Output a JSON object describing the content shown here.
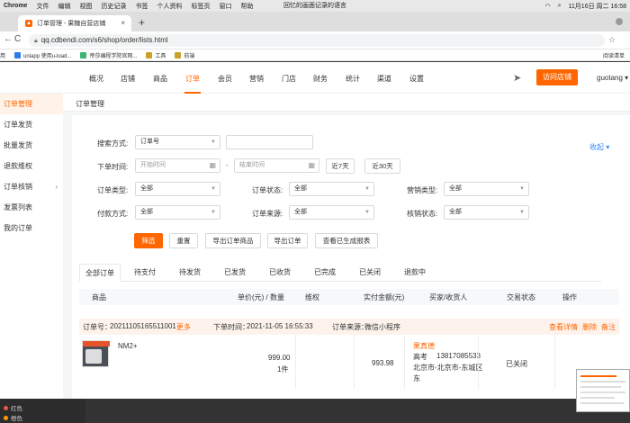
{
  "menubar": {
    "app": "Chrome",
    "items": [
      "文件",
      "编辑",
      "视图",
      "历史记录",
      "书签",
      "个人资料",
      "标签页",
      "窗口",
      "帮助"
    ],
    "center_text": "回忆的画面记录的语言",
    "clock": "11月16日 周二 16:58"
  },
  "tab": {
    "title": "订单管理 - 果糖自营店铺",
    "close": "×",
    "new": "+"
  },
  "address": {
    "url": "qq.cdbendi.com/s6/shop/order/lists.html",
    "back": "←",
    "forward": "→",
    "reload": "C",
    "star": "☆"
  },
  "bookmarks": {
    "items": [
      "用",
      "uniapp 使用u-load...",
      "帝莎编程学院官网...",
      "工具",
      "前端"
    ],
    "right": "阅读清单"
  },
  "topnav": {
    "items": [
      "概况",
      "店铺",
      "商品",
      "订单",
      "会员",
      "营销",
      "门店",
      "财务",
      "统计",
      "渠道",
      "设置"
    ],
    "active_index": 3,
    "visit_button": "访问店铺",
    "user": "guotang ▾"
  },
  "sidebar": {
    "items": [
      {
        "label": "订单管理",
        "active": true
      },
      {
        "label": "订单发货",
        "active": false
      },
      {
        "label": "批量发货",
        "active": false
      },
      {
        "label": "退款维权",
        "active": false
      },
      {
        "label": "订单核销",
        "active": false,
        "chevron": "›"
      },
      {
        "label": "发票列表",
        "active": false
      },
      {
        "label": "我的订单",
        "active": false
      }
    ]
  },
  "breadcrumb": "订单管理",
  "filters": {
    "search_label": "搜索方式:",
    "search_select": "订单号",
    "time_label": "下单时间:",
    "start_placeholder": "开始时间",
    "dash": "-",
    "end_placeholder": "结束时间",
    "last7": "近7天",
    "last30": "近30天",
    "collapse": "收起 ▾",
    "order_type_label": "订单类型:",
    "order_type": "全部",
    "order_status_label": "订单状态:",
    "order_status": "全部",
    "marketing_type_label": "营销类型:",
    "marketing_type": "全部",
    "pay_method_label": "付款方式:",
    "pay_method": "全部",
    "order_source_label": "订单来源:",
    "order_source": "全部",
    "verify_status_label": "核销状态:",
    "verify_status": "全部"
  },
  "actions": {
    "filter": "筛选",
    "reset": "重置",
    "export_goods": "导出订单商品",
    "export_orders": "导出订单",
    "view_reports": "查看已生成报表"
  },
  "order_tabs": [
    "全部订单",
    "待支付",
    "待发货",
    "已发货",
    "已收货",
    "已完成",
    "已关闭",
    "退款中"
  ],
  "table_headers": [
    "商品",
    "单价(元) / 数量",
    "维权",
    "实付金额(元)",
    "买家/收货人",
    "交易状态",
    "操作"
  ],
  "order": {
    "number_label": "订单号：",
    "number": "20211105165511001",
    "more": "更多",
    "time_label": "下单时间：",
    "time": "2021-11-05 16:55:33",
    "source_label": "订单来源：",
    "source": "微信小程序",
    "detail": "查看详情",
    "delete": "删除",
    "remark": "备注",
    "product_name": "NM2+",
    "unit_price": "999.00",
    "quantity": "1件",
    "paid": "993.98",
    "buyer": "果真德",
    "receiver_name": "高考",
    "phone": "13817085533",
    "address_line1": "北京市-北京市-东城区",
    "address_line2": "东",
    "status": "已关闭"
  },
  "bottom": {
    "red_label": "红色",
    "orange_label": "橙色"
  }
}
